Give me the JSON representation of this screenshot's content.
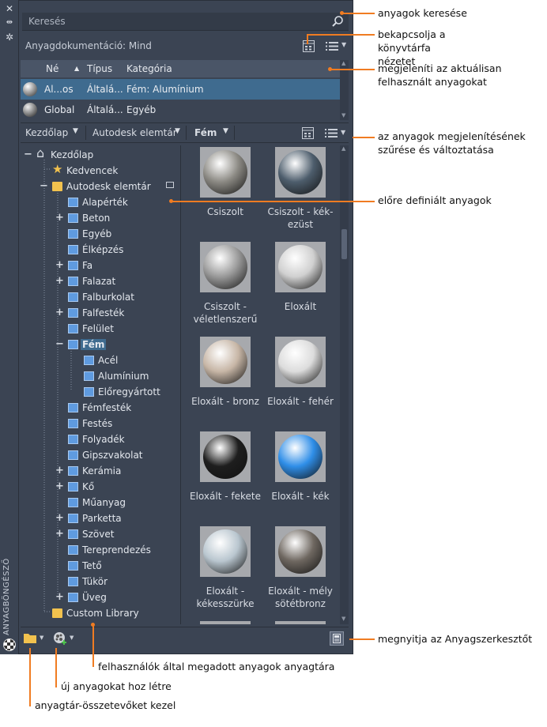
{
  "palette": {
    "vertical_title": "ANYAGBÖNGÉSZŐ",
    "search": {
      "placeholder": "Keresés"
    },
    "doc_header": "Anyagdokumentáció: Mind",
    "table": {
      "columns": [
        "Né",
        "Típus",
        "Kategória"
      ],
      "rows": [
        {
          "name": "Al...os",
          "type": "Általá...",
          "category": "Fém: Alumínium",
          "selected": true
        },
        {
          "name": "Global",
          "type": "Általá...",
          "category": "Egyéb",
          "selected": false
        }
      ]
    },
    "library_bar": {
      "crumbs": [
        "Kezdőlap",
        "Autodesk elemtár",
        "Fém"
      ]
    },
    "tree": [
      {
        "label": "Kezdőlap",
        "icon": "home-icon",
        "toggle": "−"
      },
      {
        "label": "Kedvencek",
        "icon": "star-icon",
        "toggle": ""
      },
      {
        "label": "Autodesk elemtár",
        "icon": "folder-icon",
        "toggle": "−",
        "locked": true
      },
      {
        "label": "Alapérték",
        "icon": "library-icon",
        "toggle": ""
      },
      {
        "label": "Beton",
        "icon": "library-icon",
        "toggle": "+"
      },
      {
        "label": "Egyéb",
        "icon": "library-icon",
        "toggle": ""
      },
      {
        "label": "Élképzés",
        "icon": "library-icon",
        "toggle": ""
      },
      {
        "label": "Fa",
        "icon": "library-icon",
        "toggle": "+"
      },
      {
        "label": "Falazat",
        "icon": "library-icon",
        "toggle": "+"
      },
      {
        "label": "Falburkolat",
        "icon": "library-icon",
        "toggle": ""
      },
      {
        "label": "Falfesték",
        "icon": "library-icon",
        "toggle": "+"
      },
      {
        "label": "Felület",
        "icon": "library-icon",
        "toggle": ""
      },
      {
        "label": "Fém",
        "icon": "library-icon",
        "toggle": "−",
        "selected": true
      },
      {
        "label": "Acél",
        "icon": "library-icon",
        "toggle": ""
      },
      {
        "label": "Alumínium",
        "icon": "library-icon",
        "toggle": ""
      },
      {
        "label": "Előregyártott",
        "icon": "library-icon",
        "toggle": ""
      },
      {
        "label": "Fémfesték",
        "icon": "library-icon",
        "toggle": ""
      },
      {
        "label": "Festés",
        "icon": "library-icon",
        "toggle": ""
      },
      {
        "label": "Folyadék",
        "icon": "library-icon",
        "toggle": ""
      },
      {
        "label": "Gipszvakolat",
        "icon": "library-icon",
        "toggle": ""
      },
      {
        "label": "Kerámia",
        "icon": "library-icon",
        "toggle": "+"
      },
      {
        "label": "Kő",
        "icon": "library-icon",
        "toggle": "+"
      },
      {
        "label": "Műanyag",
        "icon": "library-icon",
        "toggle": ""
      },
      {
        "label": "Parketta",
        "icon": "library-icon",
        "toggle": "+"
      },
      {
        "label": "Szövet",
        "icon": "library-icon",
        "toggle": "+"
      },
      {
        "label": "Tereprendezés",
        "icon": "library-icon",
        "toggle": ""
      },
      {
        "label": "Tető",
        "icon": "library-icon",
        "toggle": ""
      },
      {
        "label": "Tükör",
        "icon": "library-icon",
        "toggle": ""
      },
      {
        "label": "Üveg",
        "icon": "library-icon",
        "toggle": "+"
      },
      {
        "label": "Custom Library",
        "icon": "folder-icon",
        "toggle": ""
      }
    ],
    "swatches": [
      {
        "label": "Csiszolt",
        "color": "#8c8a84"
      },
      {
        "label": "Csiszolt - kék-ezüst",
        "color": "#4d5d6c"
      },
      {
        "label": "Csiszolt - véletlenszerű",
        "color": "#9a9a9a"
      },
      {
        "label": "Eloxált",
        "color": "#d0d0d0"
      },
      {
        "label": "Eloxált - bronz",
        "color": "#c7b6a6"
      },
      {
        "label": "Eloxált - fehér",
        "color": "#dcdcdc"
      },
      {
        "label": "Eloxált - fekete",
        "color": "#1e1e1e"
      },
      {
        "label": "Eloxált - kék",
        "color": "#2f8ee8"
      },
      {
        "label": "Eloxált - kékesszürke",
        "color": "#b9c6cf"
      },
      {
        "label": "Eloxált - mély sötétbronz",
        "color": "#6e6760"
      }
    ]
  },
  "callouts": {
    "search": "anyagok keresése",
    "toggle_view": "bekapcsolja a könyvtárfa nézetet",
    "current": "megjeleníti az aktuálisan felhasznált anyagokat",
    "filter": "az anyagok megjelenítésének szűrése és változtatása",
    "predefined": "előre definiált anyagok",
    "editor": "megnyitja az Anyagszerkesztőt",
    "user_lib": "felhasználók által megadott anyagok anyagtára",
    "create": "új anyagokat hoz létre",
    "manage": "anyagtár-összetevőket kezel"
  },
  "colors": {
    "accent": "#f07c22",
    "panel": "#3b4453",
    "selection": "#3f6b8f"
  }
}
